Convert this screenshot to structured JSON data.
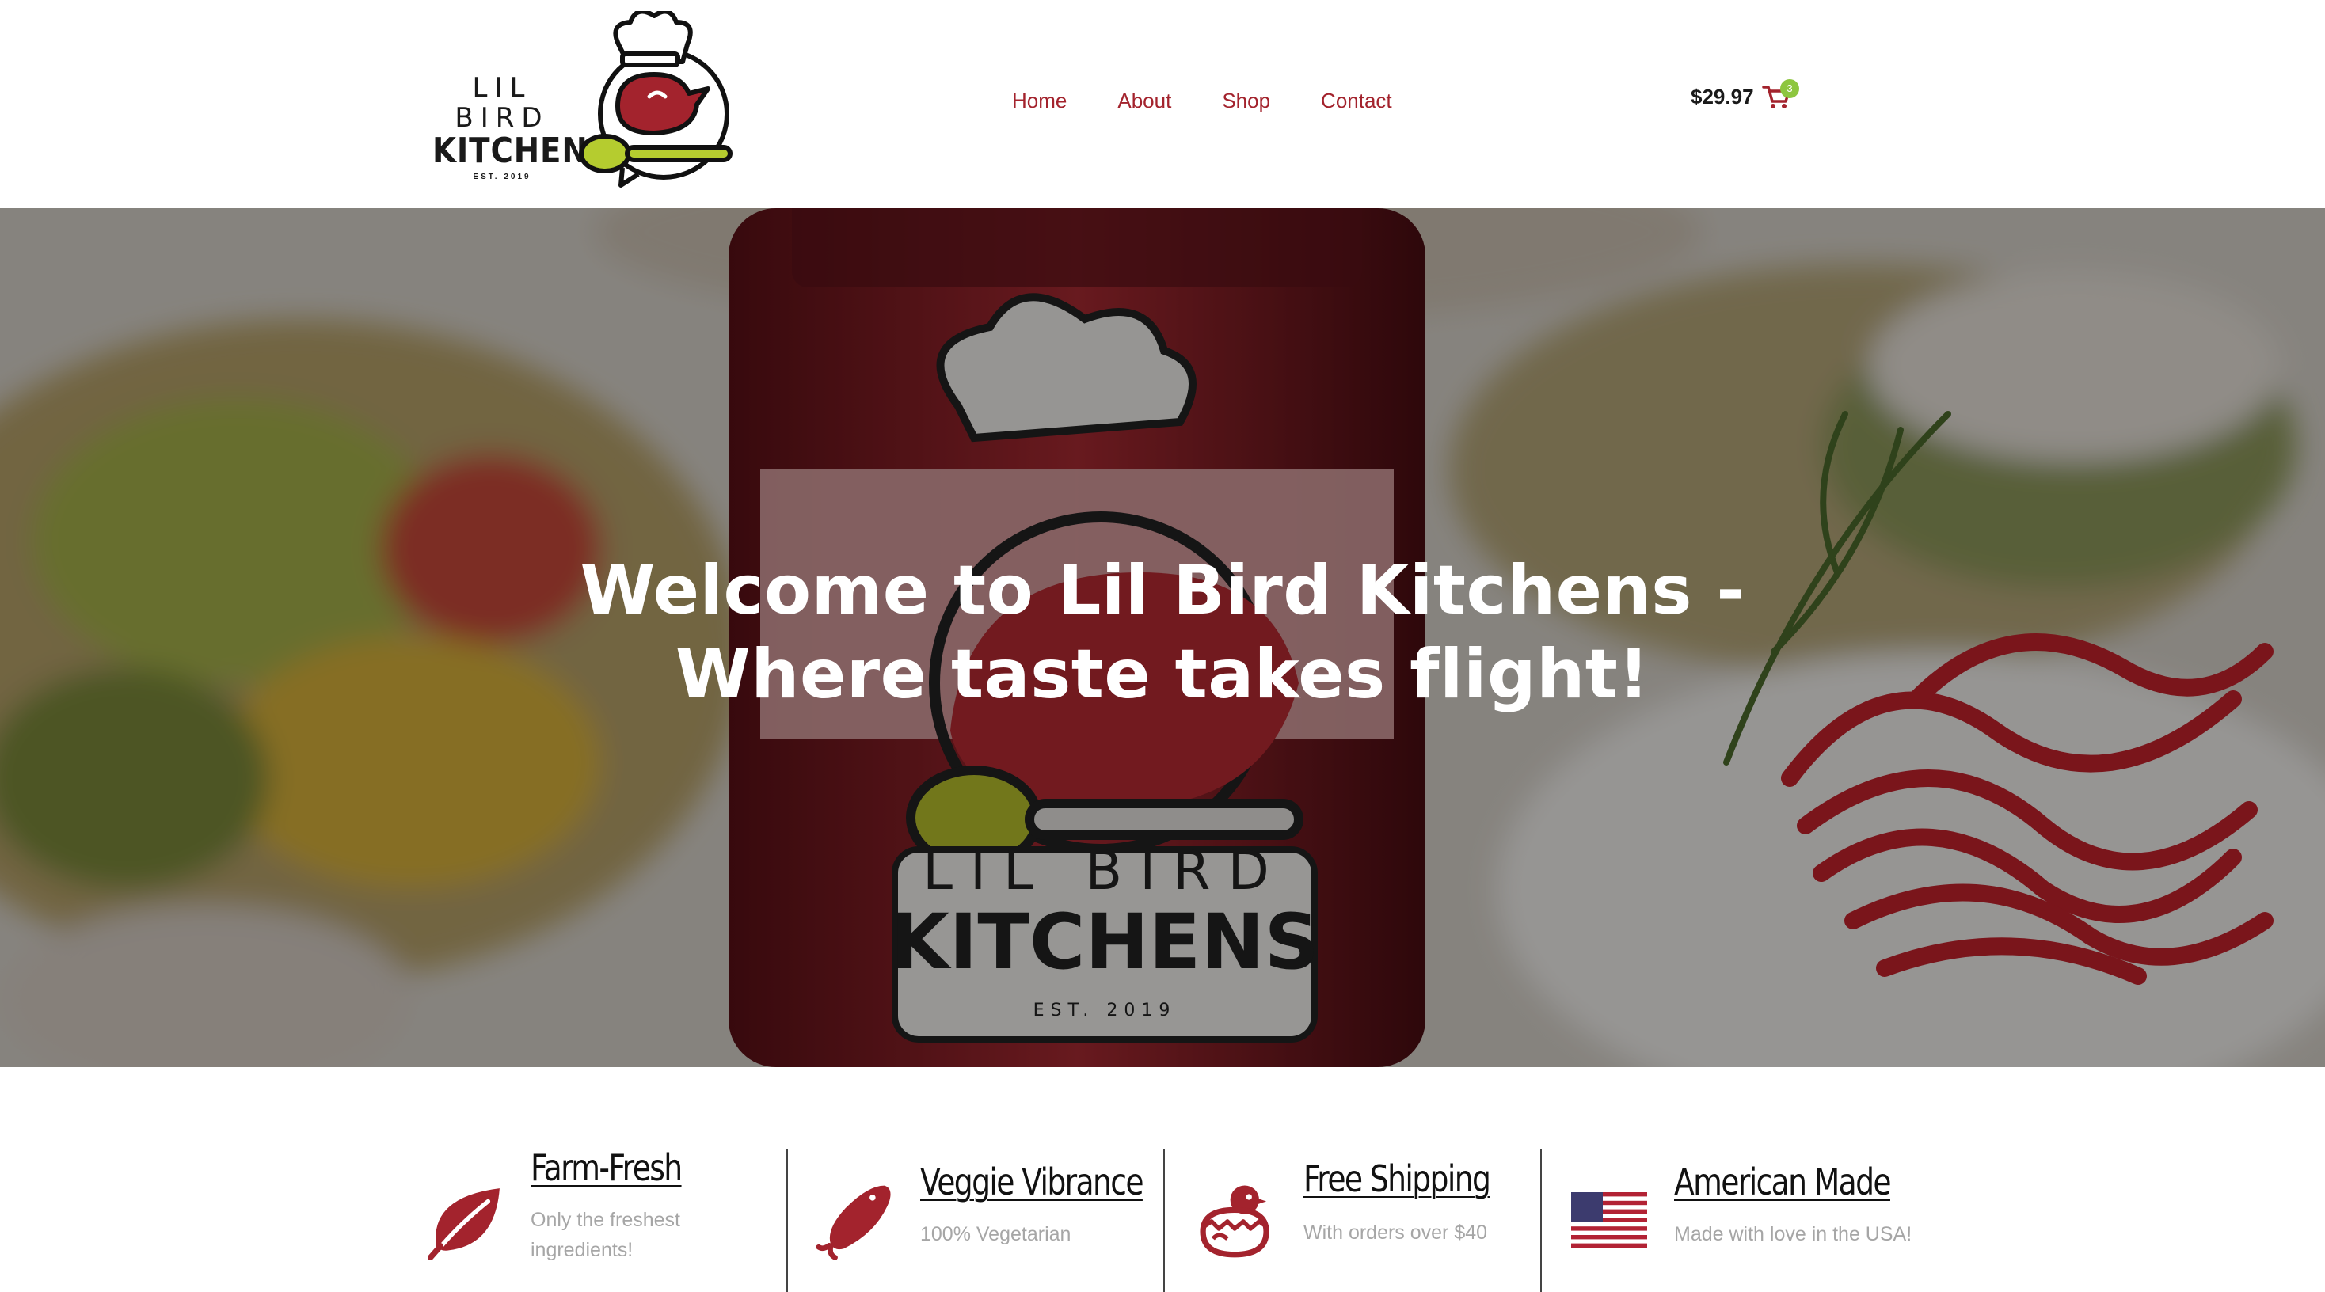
{
  "brand": {
    "logo_line1": "LIL BIRD",
    "logo_line2": "KITCHENS",
    "logo_est": "EST. 2019"
  },
  "nav": {
    "items": [
      {
        "label": "Home"
      },
      {
        "label": "About"
      },
      {
        "label": "Shop"
      },
      {
        "label": "Contact"
      }
    ]
  },
  "cart": {
    "total": "$29.97",
    "count": "3",
    "icon": "cart-icon"
  },
  "hero": {
    "title_line1": "Welcome to Lil Bird Kitchens -",
    "title_line2": "Where taste takes flight!"
  },
  "features": [
    {
      "title": "Farm-Fresh",
      "subtitle_line1": "Only the freshest",
      "subtitle_line2": "ingredients!",
      "icon": "leaf-icon"
    },
    {
      "title": "Veggie Vibrance",
      "subtitle_line1": "100% Vegetarian",
      "icon": "pepper-icon"
    },
    {
      "title": "Free Shipping",
      "subtitle_line1": "With orders over $40",
      "icon": "hatching-bird-icon"
    },
    {
      "title": "American Made",
      "subtitle_line1": "Made with love in the USA!",
      "icon": "us-flag-icon"
    }
  ],
  "colors": {
    "brand_red": "#a3232d",
    "brand_green": "#8dc63f",
    "text_dark": "#1a1a1a",
    "text_muted": "#a6a6a6"
  }
}
